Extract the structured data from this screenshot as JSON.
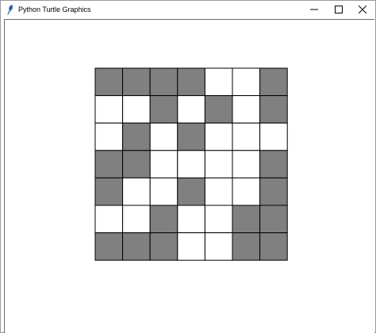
{
  "window": {
    "title": "Python Turtle Graphics",
    "minimize_icon": "minimize-icon",
    "maximize_icon": "maximize-icon",
    "close_icon": "close-icon",
    "app_icon": "feather-icon"
  },
  "grid": {
    "rows": 7,
    "cols": 7,
    "filled_color": "#808080",
    "empty_color": "#ffffff",
    "line_color": "#000000",
    "cells": [
      [
        1,
        1,
        1,
        1,
        0,
        0,
        1
      ],
      [
        0,
        0,
        1,
        0,
        1,
        0,
        1
      ],
      [
        0,
        1,
        0,
        1,
        0,
        0,
        0
      ],
      [
        1,
        1,
        0,
        0,
        0,
        0,
        1
      ],
      [
        1,
        0,
        0,
        1,
        0,
        0,
        1
      ],
      [
        0,
        0,
        1,
        0,
        0,
        1,
        1
      ],
      [
        1,
        1,
        1,
        0,
        0,
        1,
        1
      ]
    ]
  }
}
